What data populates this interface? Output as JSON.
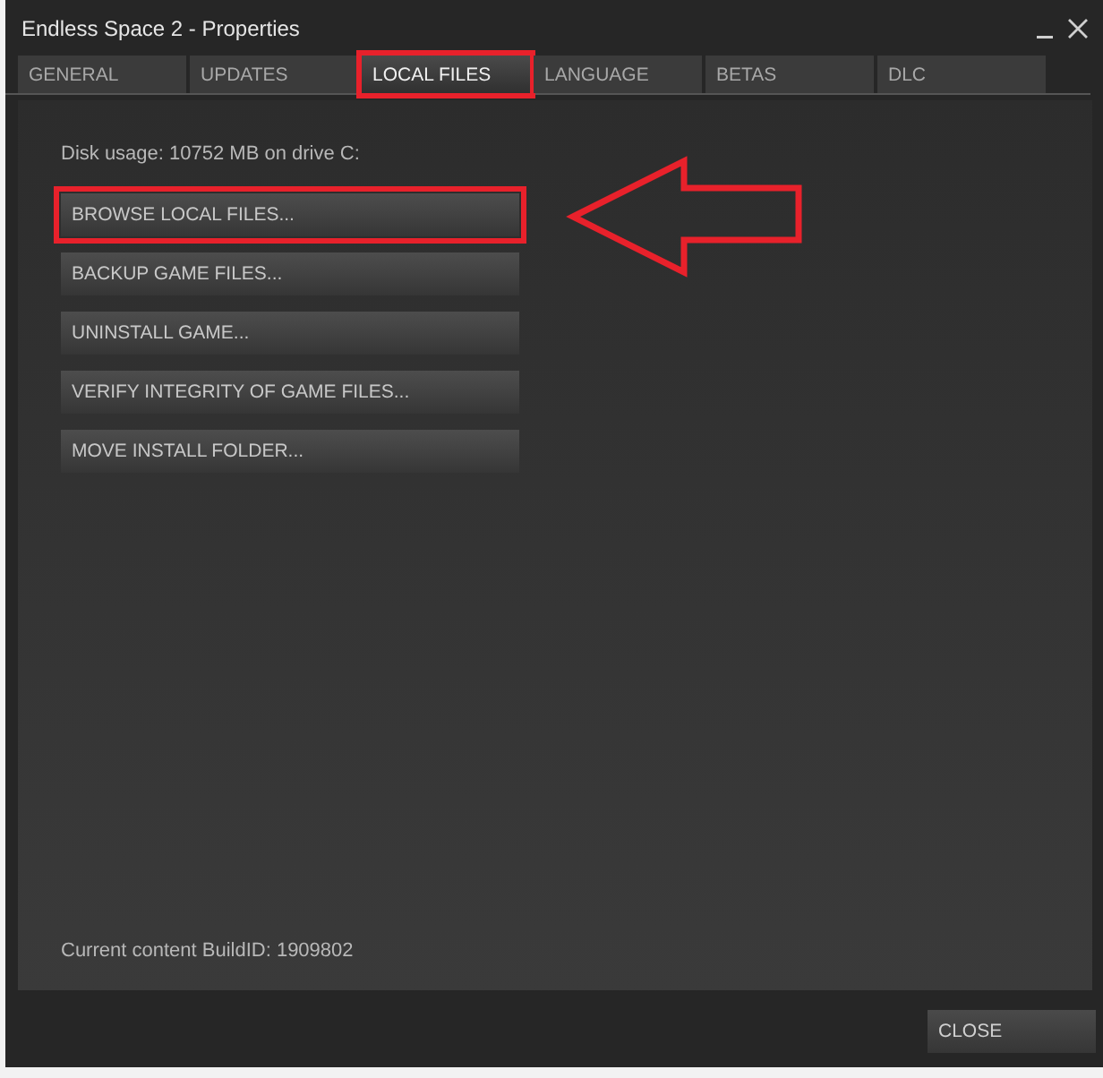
{
  "window": {
    "title": "Endless Space 2 - Properties"
  },
  "tabs": [
    {
      "label": "GENERAL",
      "selected": false,
      "highlighted": false
    },
    {
      "label": "UPDATES",
      "selected": false,
      "highlighted": false
    },
    {
      "label": "LOCAL FILES",
      "selected": true,
      "highlighted": true
    },
    {
      "label": "LANGUAGE",
      "selected": false,
      "highlighted": false
    },
    {
      "label": "BETAS",
      "selected": false,
      "highlighted": false
    },
    {
      "label": "DLC",
      "selected": false,
      "highlighted": false
    }
  ],
  "disk_usage": "Disk usage: 10752 MB on drive C:",
  "actions": [
    {
      "label": "BROWSE LOCAL FILES...",
      "highlighted": true
    },
    {
      "label": "BACKUP GAME FILES...",
      "highlighted": false
    },
    {
      "label": "UNINSTALL GAME...",
      "highlighted": false
    },
    {
      "label": "VERIFY INTEGRITY OF GAME FILES...",
      "highlighted": false
    },
    {
      "label": "MOVE INSTALL FOLDER...",
      "highlighted": false
    }
  ],
  "build_id": "Current content BuildID: 1909802",
  "buttons": [
    "CLOSE"
  ]
}
